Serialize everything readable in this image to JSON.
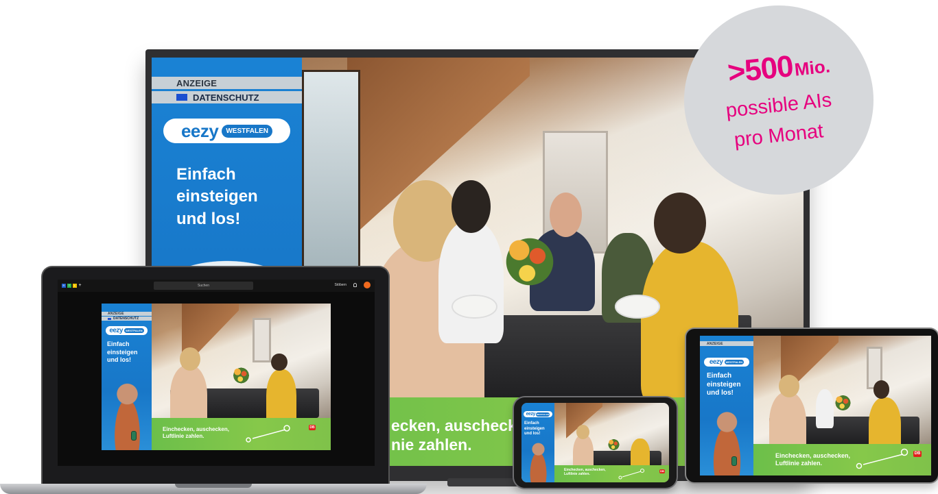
{
  "badge": {
    "number": ">500",
    "unit": "Mio.",
    "line1": "possible AIs",
    "line2": "pro Monat"
  },
  "ad": {
    "label_anzeige": "ANZEIGE",
    "label_datenschutz": "DATENSCHUTZ",
    "brand": "eezy",
    "brand_region": "WESTFALEN",
    "headline_1": "Einfach",
    "headline_2": "einsteigen",
    "headline_3": "und los!",
    "claim_1": "Einchecken, auschecken,",
    "claim_2": "Luftlinie zahlen.",
    "tv_claim_1": "ecken, auschecken,",
    "tv_claim_2": "nie zahlen.",
    "db_logo": "DB"
  },
  "laptop": {
    "search_label": "Suchen",
    "top_right_label": "Stöbern",
    "rtl_letters": [
      "R",
      "T",
      "L"
    ],
    "rtl_plus": "+"
  },
  "colors": {
    "ad_blue": "#1877c8",
    "ad_green": "#7fc24a",
    "badge_magenta": "#e6007e",
    "db_red": "#e2211c",
    "rtl_red": "#1f5fd0",
    "rtl_green": "#2bb24c",
    "rtl_yellow": "#f2c200"
  }
}
